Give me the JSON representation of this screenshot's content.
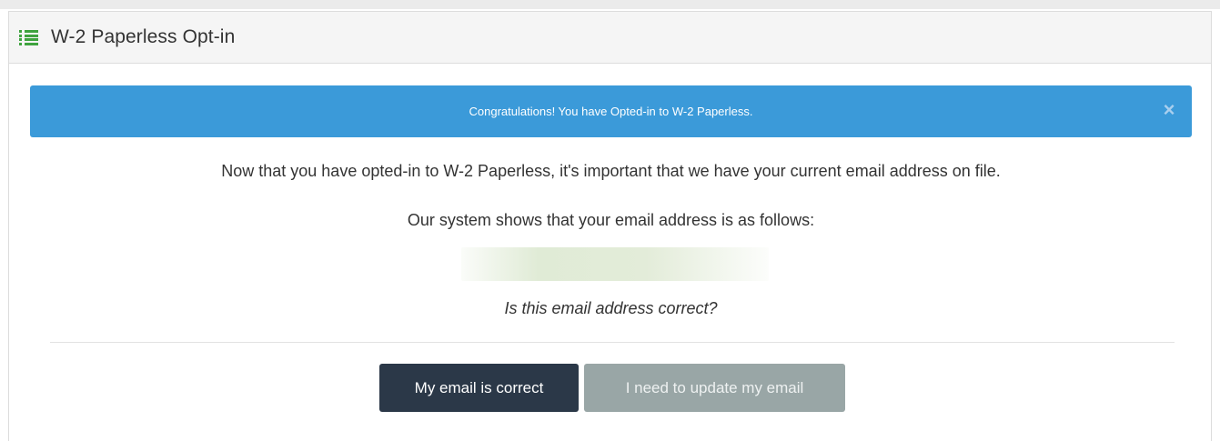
{
  "panel": {
    "title": "W-2 Paperless Opt-in",
    "icon": "list-icon",
    "accent_color": "#3fa33f"
  },
  "alert": {
    "message": "Congratulations! You have Opted-in to W-2 Paperless.",
    "close_symbol": "×",
    "background_color": "#3b9ad9"
  },
  "body": {
    "line_1": "Now that you have opted-in to W-2 Paperless, it's important that we have your current email address on file.",
    "line_2": "Our system shows that your email address is as follows:",
    "question": "Is this email address correct?"
  },
  "actions": {
    "correct_label": "My email is correct",
    "update_label": "I need to update my email",
    "correct_color": "#2b3848",
    "update_color": "#99a6a6"
  }
}
